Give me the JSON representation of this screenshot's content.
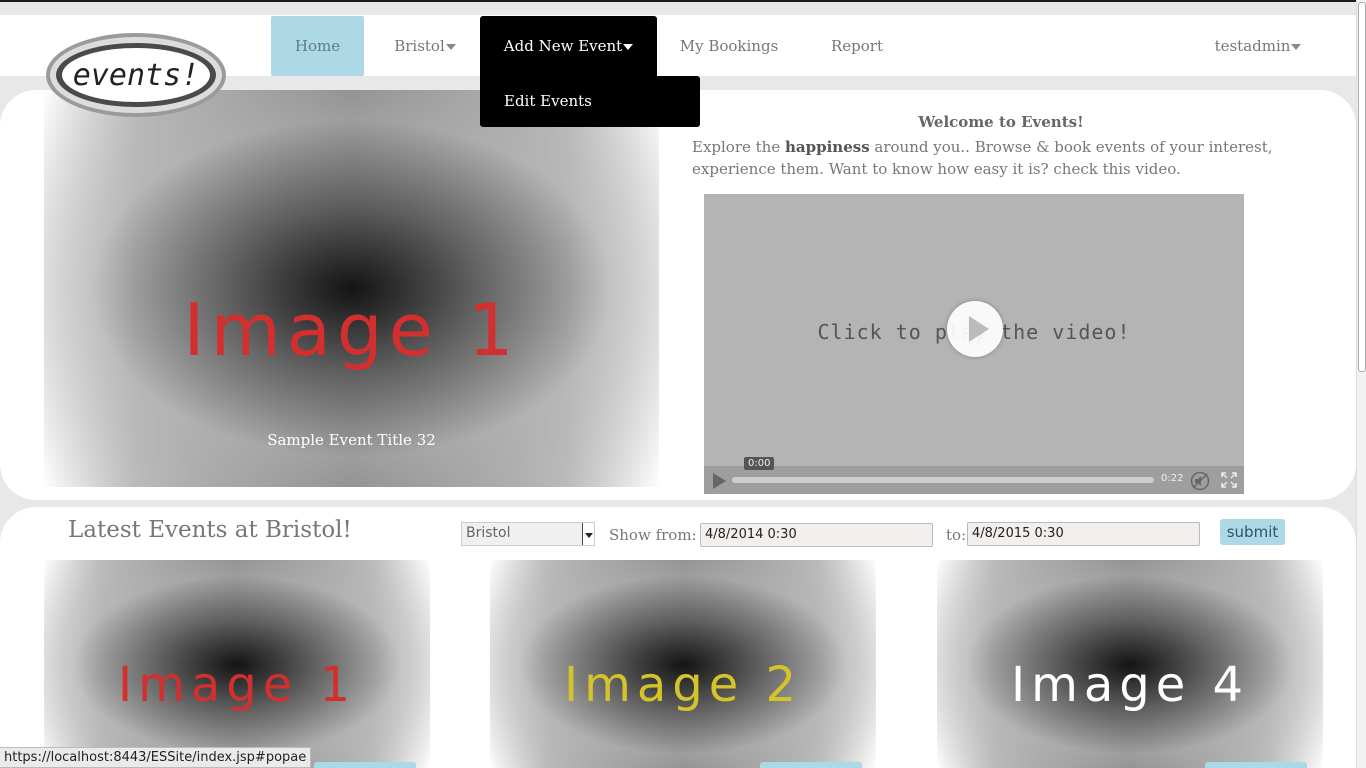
{
  "nav": {
    "home": "Home",
    "city": "Bristol",
    "add_new_event": "Add New Event",
    "my_bookings": "My Bookings",
    "report": "Report",
    "user": "testadmin",
    "dropdown_item": "Edit Events"
  },
  "logo": {
    "text": "events!"
  },
  "hero": {
    "slide_image_text": "Image 1",
    "slide_caption": "Sample Event Title 32",
    "welcome_title": "Welcome to Events!",
    "welcome_pre": "Explore the ",
    "welcome_bold": "happiness",
    "welcome_post": " around you.. Browse & book events of your interest, experience them. Want to know how easy it is? check this video."
  },
  "video": {
    "overlay_text": "Click to play the video!",
    "current_time": "0:00",
    "duration": "0:22",
    "progress_fraction": 0
  },
  "latest": {
    "title": "Latest Events at Bristol!",
    "city_selected": "Bristol",
    "from_label": "Show from:",
    "from_value": "4/8/2014 0:30",
    "to_label": "to:",
    "to_value": "4/8/2015 0:30",
    "submit": "submit",
    "thumbs": [
      {
        "text": "Image 1",
        "color": "#d32f2f"
      },
      {
        "text": "Image 2",
        "color": "#d4c32a"
      },
      {
        "text": "Image 4",
        "color": "#ffffff"
      }
    ]
  },
  "status_url": "https://localhost:8443/ESSite/index.jsp#popae"
}
